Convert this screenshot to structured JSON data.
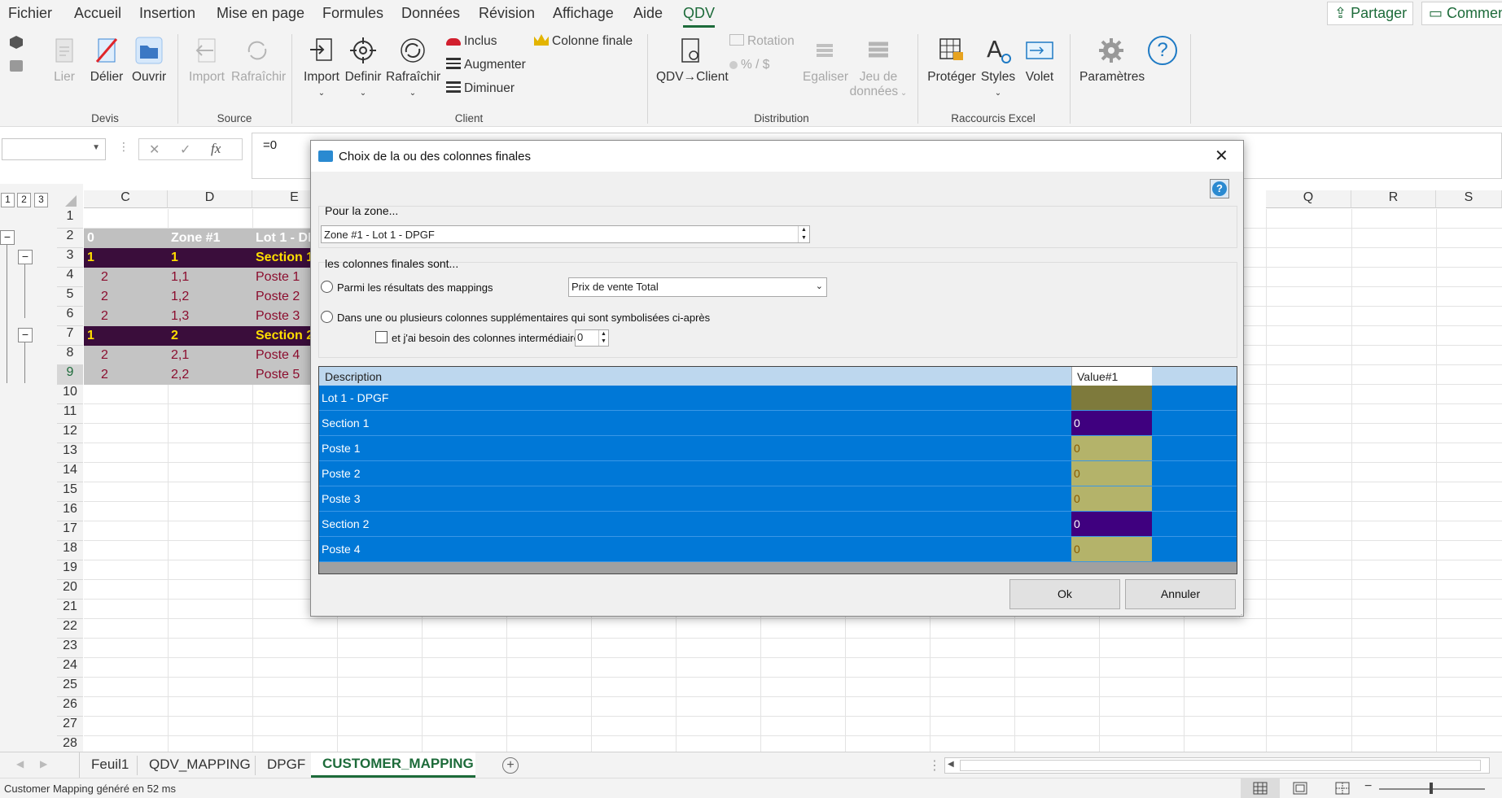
{
  "menu": {
    "items": [
      "Fichier",
      "Accueil",
      "Insertion",
      "Mise en page",
      "Formules",
      "Données",
      "Révision",
      "Affichage",
      "Aide",
      "QDV"
    ],
    "share": "Partager",
    "comments": "Commen"
  },
  "ribbon": {
    "devis": {
      "lier": "Lier",
      "delier": "Délier",
      "ouvrir": "Ouvrir",
      "label": "Devis"
    },
    "source": {
      "import": "Import",
      "rafraichir": "Rafraîchir",
      "label": "Source"
    },
    "client": {
      "import": "Import",
      "definir": "Definir",
      "rafraichir": "Rafraîchir",
      "inclus": "Inclus",
      "augmenter": "Augmenter",
      "diminuer": "Diminuer",
      "colonne_finale": "Colonne finale",
      "label": "Client"
    },
    "distribution": {
      "qdv_client": "QDV→Client",
      "rotation": "Rotation",
      "percent": "% / $",
      "egaliser": "Egaliser",
      "jeu": "Jeu de",
      "donnees": "données",
      "label": "Distribution"
    },
    "raccourcis": {
      "proteger": "Protéger",
      "styles": "Styles",
      "volet": "Volet",
      "label": "Raccourcis Excel"
    },
    "parametres": {
      "label": "Paramètres"
    },
    "help_glyph": "?"
  },
  "formula": {
    "fx": "fx",
    "value": "=0",
    "cancel": "✕",
    "enter": "✓"
  },
  "outline_levels": [
    "1",
    "2",
    "3"
  ],
  "columns": {
    "left": [
      "C",
      "D",
      "E"
    ],
    "right": [
      "Q",
      "R",
      "S"
    ]
  },
  "rows": [
    "1",
    "2",
    "3",
    "4",
    "5",
    "6",
    "7",
    "8",
    "9",
    "10",
    "11",
    "12",
    "13",
    "14",
    "15",
    "16",
    "17",
    "18",
    "19",
    "20",
    "21",
    "22",
    "23",
    "24",
    "25",
    "26",
    "27",
    "28"
  ],
  "sheet_rows": [
    {
      "c": "0",
      "d": "Zone #1",
      "e": "Lot 1 - DI"
    },
    {
      "c": "1",
      "d": "1",
      "e": "Section 1"
    },
    {
      "c": "2",
      "d": "1,1",
      "e": "Poste 1"
    },
    {
      "c": "2",
      "d": "1,2",
      "e": "Poste 2"
    },
    {
      "c": "2",
      "d": "1,3",
      "e": "Poste 3"
    },
    {
      "c": "1",
      "d": "2",
      "e": "Section 2"
    },
    {
      "c": "2",
      "d": "2,1",
      "e": "Poste 4"
    },
    {
      "c": "2",
      "d": "2,2",
      "e": "Poste 5"
    }
  ],
  "dialog": {
    "title": "Choix de la ou des colonnes finales",
    "help_glyph": "?",
    "zone_label": "Pour la zone...",
    "zone_value": "Zone #1 - Lot 1 - DPGF",
    "cols_label": "les colonnes finales sont...",
    "radio1": "Parmi les résultats des mappings",
    "select_value": "Prix de vente Total",
    "radio2": "Dans une ou plusieurs colonnes supplémentaires qui sont symbolisées ci-après",
    "checkbox_label": "et j'ai besoin des colonnes intermédiaires",
    "spinner_value": "0",
    "table": {
      "headers": [
        "Description",
        "Value#1"
      ],
      "rows": [
        {
          "desc": "Lot 1 - DPGF",
          "val": ""
        },
        {
          "desc": "Section 1",
          "val": "0"
        },
        {
          "desc": "Poste 1",
          "val": "0"
        },
        {
          "desc": "Poste 2",
          "val": "0"
        },
        {
          "desc": "Poste 3",
          "val": "0"
        },
        {
          "desc": "Section 2",
          "val": "0"
        },
        {
          "desc": "Poste 4",
          "val": "0"
        }
      ]
    },
    "ok": "Ok",
    "cancel": "Annuler"
  },
  "tabs": [
    "Feuil1",
    "QDV_MAPPING",
    "DPGF",
    "CUSTOMER_MAPPING"
  ],
  "active_tab": "CUSTOMER_MAPPING",
  "status": {
    "text": "Customer Mapping généré en 52 ms"
  },
  "colors": {
    "accent": "#1d6b3a",
    "section_bg": "#3a0d3b",
    "section_text": "#ffde00",
    "poste_bg": "#c4c4c4",
    "poste_text": "#8b0d2e",
    "table_blue": "#0078d7",
    "value_section": "#3f007f",
    "value_poste": "#b4b36a",
    "value_lot": "#7e7a3c"
  }
}
